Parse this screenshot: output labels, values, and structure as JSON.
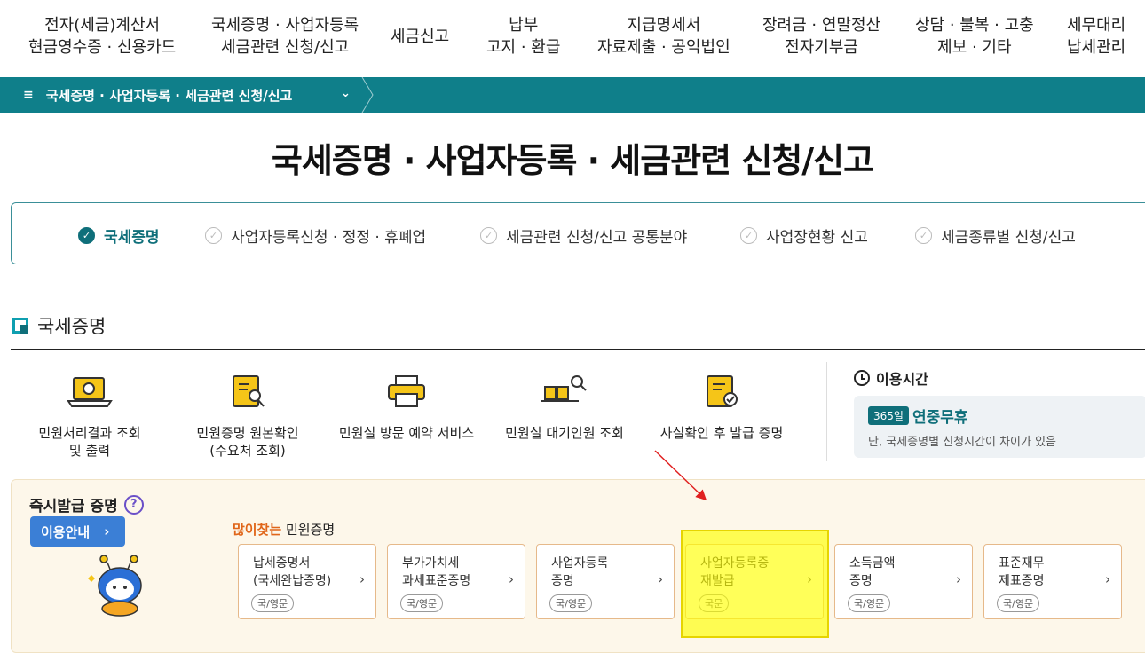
{
  "topnav": [
    {
      "line1": "전자(세금)계산서",
      "line2": "현금영수증 · 신용카드"
    },
    {
      "line1": "국세증명 · 사업자등록",
      "line2": "세금관련 신청/신고"
    },
    {
      "line1": "세금신고",
      "line2": ""
    },
    {
      "line1": "납부",
      "line2": "고지 · 환급"
    },
    {
      "line1": "지급명세서",
      "line2": "자료제출 · 공익법인"
    },
    {
      "line1": "장려금 · 연말정산",
      "line2": "전자기부금"
    },
    {
      "line1": "상담 · 불복 · 고충",
      "line2": "제보 · 기타"
    },
    {
      "line1": "세무대리",
      "line2": "납세관리"
    }
  ],
  "breadcrumb": {
    "label": "국세증명 · 사업자등록 · 세금관련 신청/신고",
    "menu_glyph": "≡",
    "chevron": "⌄"
  },
  "page_title": "국세증명 · 사업자등록 · 세금관련 신청/신고",
  "tabs": [
    {
      "label": "국세증명",
      "active": true
    },
    {
      "label": "사업자등록신청 · 정정 · 휴폐업",
      "active": false
    },
    {
      "label": "세금관련 신청/신고 공통분야",
      "active": false
    },
    {
      "label": "사업장현황 신고",
      "active": false
    },
    {
      "label": "세금종류별 신청/신고",
      "active": false
    }
  ],
  "section_title": "국세증명",
  "services": [
    {
      "line1": "민원처리결과 조회",
      "line2": "및 출력",
      "icon": "laptop-icon"
    },
    {
      "line1": "민원증명 원본확인",
      "line2": "(수요처 조회)",
      "icon": "document-search-icon"
    },
    {
      "line1": "민원실 방문 예약 서비스",
      "line2": "",
      "icon": "printer-icon"
    },
    {
      "line1": "민원실 대기인원 조회",
      "line2": "",
      "icon": "waiting-seats-icon"
    },
    {
      "line1": "사실확인 후 발급 증명",
      "line2": "",
      "icon": "certificate-check-icon"
    }
  ],
  "hours": {
    "title": "이용시간",
    "badge": "365일",
    "main": "연중무휴",
    "note": "단, 국세증명별 신청시간이 차이가 있음"
  },
  "instant": {
    "title": "즉시발급 증명",
    "help": "?",
    "guide_label": "이용안내",
    "popular_highlight": "많이찾는",
    "popular_rest": " 민원증명"
  },
  "cards": [
    {
      "line1": "납세증명서",
      "line2": "(국세완납증명)",
      "tag": "국/영문"
    },
    {
      "line1": "부가가치세",
      "line2": "과세표준증명",
      "tag": "국/영문"
    },
    {
      "line1": "사업자등록",
      "line2": "증명",
      "tag": "국/영문"
    },
    {
      "line1": "사업자등록증",
      "line2": "재발급",
      "tag": "국문"
    },
    {
      "line1": "소득금액",
      "line2": "증명",
      "tag": "국/영문"
    },
    {
      "line1": "표준재무",
      "line2": "제표증명",
      "tag": "국/영문"
    }
  ],
  "colors": {
    "teal": "#0f7f8a",
    "highlight": "#ffff00",
    "annotation_arrow": "#e02020",
    "guide_button": "#3b7fd6"
  }
}
